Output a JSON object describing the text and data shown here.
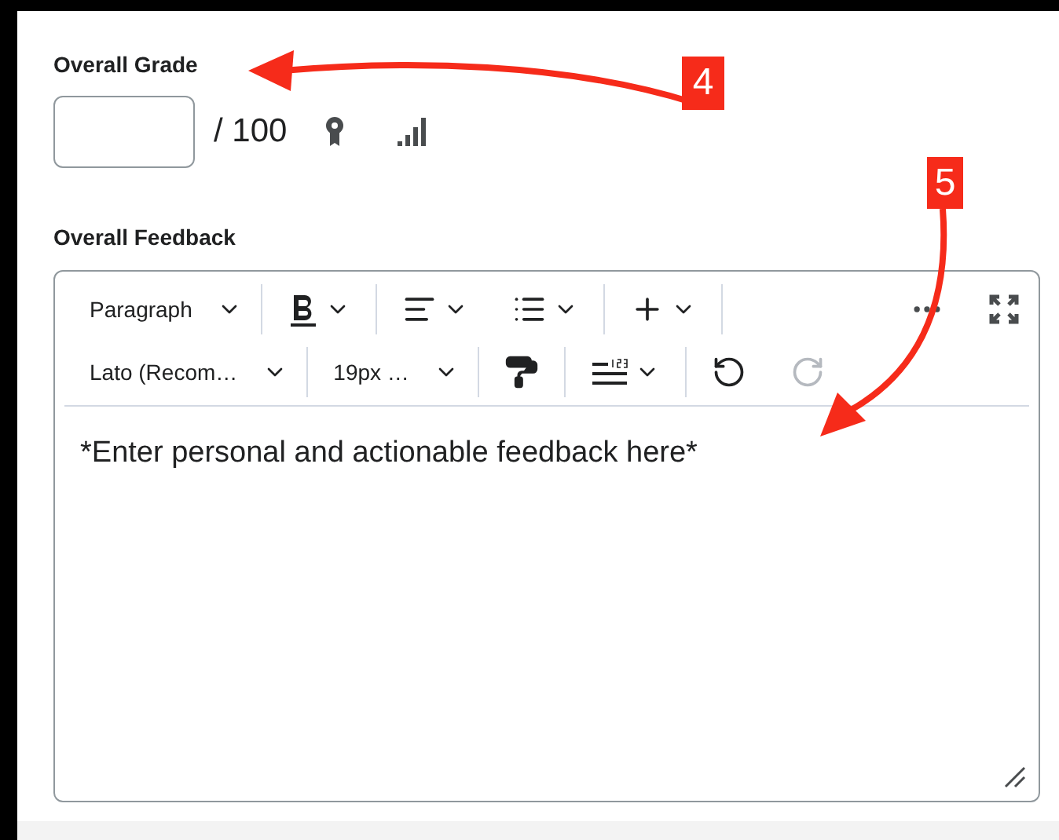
{
  "grade": {
    "label": "Overall Grade",
    "out_of": "/ 100"
  },
  "feedback": {
    "label": "Overall Feedback",
    "toolbar": [
      [
        [
          {
            "kind": "select",
            "label": "Paragraph",
            "disabled": false
          }
        ],
        [
          {
            "kind": "bold",
            "disabled": false
          }
        ],
        [
          {
            "kind": "align",
            "disabled": false
          },
          {
            "kind": "list",
            "disabled": false
          }
        ],
        [
          {
            "kind": "insert",
            "disabled": false
          }
        ]
      ],
      [
        [
          {
            "kind": "select",
            "label": "Lato (Recom…",
            "disabled": false
          }
        ],
        [
          {
            "kind": "select",
            "label": "19px …",
            "disabled": false
          }
        ],
        [
          {
            "kind": "painter",
            "disabled": false
          }
        ],
        [
          {
            "kind": "spacing",
            "disabled": false
          }
        ],
        [
          {
            "kind": "undo",
            "disabled": false
          },
          {
            "kind": "redo",
            "disabled": true
          }
        ]
      ]
    ],
    "text": "*Enter personal and actionable feedback here*"
  },
  "callouts": [
    {
      "number": "4"
    },
    {
      "number": "5"
    }
  ]
}
